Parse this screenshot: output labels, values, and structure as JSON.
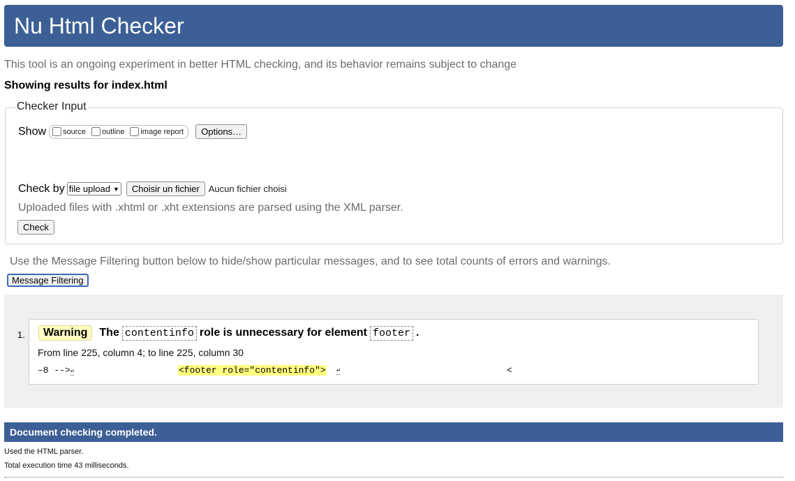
{
  "header": {
    "title": "Nu Html Checker"
  },
  "intro": "This tool is an ongoing experiment in better HTML checking, and its behavior remains subject to change",
  "showing": "Showing results for index.html",
  "checker_input": {
    "legend": "Checker Input",
    "show_label": "Show",
    "show_options": [
      {
        "label": "source",
        "checked": false
      },
      {
        "label": "outline",
        "checked": false
      },
      {
        "label": "image report",
        "checked": false
      }
    ],
    "options_button": "Options…",
    "check_by_label": "Check by",
    "check_by_selected": "file upload",
    "file_button": "Choisir un fichier",
    "file_status": "Aucun fichier choisi",
    "xml_note": "Uploaded files with .xhtml or .xht extensions are parsed using the XML parser.",
    "check_button": "Check"
  },
  "filter": {
    "note": "Use the Message Filtering button below to hide/show particular messages, and to see total counts of errors and warnings.",
    "button": "Message Filtering"
  },
  "messages": [
    {
      "number": "1.",
      "type": "Warning",
      "text_pre": "The",
      "code1": "contentinfo",
      "text_mid": "role is unnecessary for element",
      "code2": "footer",
      "text_post": ".",
      "location": "From line 225, column 4; to line 225, column 30",
      "extract_before": "–8 -->",
      "extract_highlight": "<footer role=\"contentinfo\">",
      "extract_after": "<",
      "newline_glyph": "↩"
    }
  ],
  "completion": {
    "title": "Document checking completed.",
    "parser_note": "Used the HTML parser.",
    "time_note": "Total execution time 43 milliseconds."
  }
}
